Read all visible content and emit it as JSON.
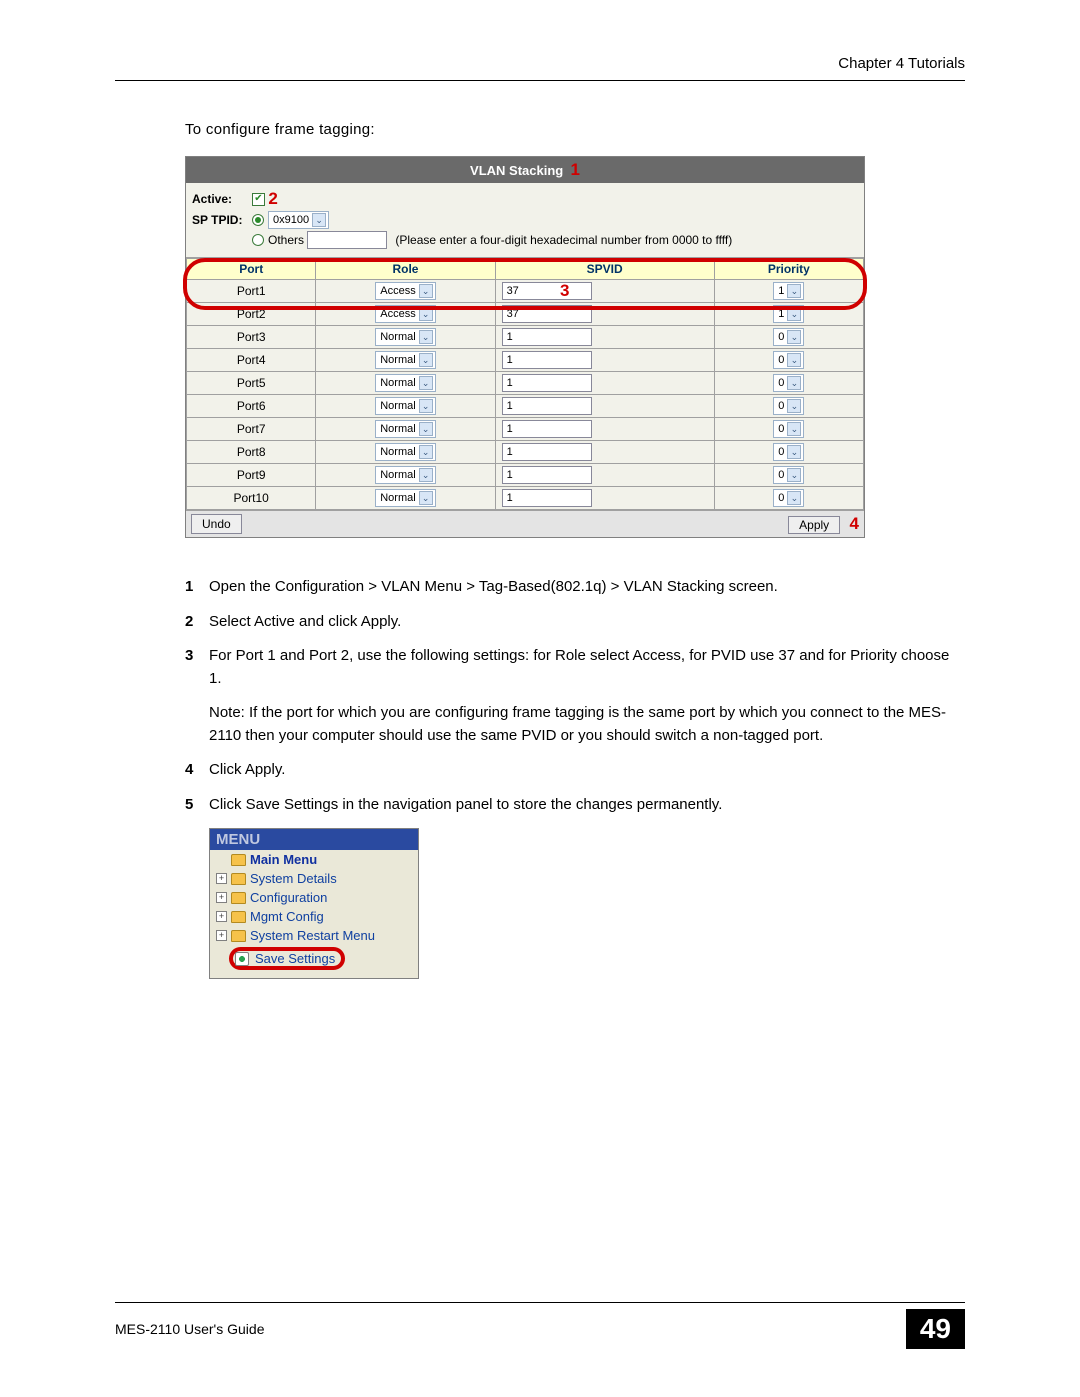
{
  "header": {
    "chapter": "Chapter 4 Tutorials"
  },
  "intro": "To configure frame tagging:",
  "vlan": {
    "title": "VLAN Stacking",
    "callout1": "1",
    "active_label": "Active:",
    "callout2": "2",
    "sptpid_label": "SP TPID:",
    "tpid_value": "0x9100",
    "others_label": "Others",
    "hint": "(Please enter a four-digit hexadecimal number from 0000 to ffff)",
    "headers": {
      "port": "Port",
      "role": "Role",
      "spvid": "SPVID",
      "priority": "Priority"
    },
    "rows": [
      {
        "port": "Port1",
        "role": "Access",
        "spvid": "37",
        "priority": "1"
      },
      {
        "port": "Port2",
        "role": "Access",
        "spvid": "37",
        "priority": "1"
      },
      {
        "port": "Port3",
        "role": "Normal",
        "spvid": "1",
        "priority": "0"
      },
      {
        "port": "Port4",
        "role": "Normal",
        "spvid": "1",
        "priority": "0"
      },
      {
        "port": "Port5",
        "role": "Normal",
        "spvid": "1",
        "priority": "0"
      },
      {
        "port": "Port6",
        "role": "Normal",
        "spvid": "1",
        "priority": "0"
      },
      {
        "port": "Port7",
        "role": "Normal",
        "spvid": "1",
        "priority": "0"
      },
      {
        "port": "Port8",
        "role": "Normal",
        "spvid": "1",
        "priority": "0"
      },
      {
        "port": "Port9",
        "role": "Normal",
        "spvid": "1",
        "priority": "0"
      },
      {
        "port": "Port10",
        "role": "Normal",
        "spvid": "1",
        "priority": "0"
      }
    ],
    "callout3": "3",
    "undo": "Undo",
    "apply": "Apply",
    "callout4": "4"
  },
  "steps": {
    "s1_num": "1",
    "s1": "Open the Configuration > VLAN Menu > Tag-Based(802.1q) > VLAN Stacking screen.",
    "s2_num": "2",
    "s2": "Select Active and click Apply.",
    "s3_num": "3",
    "s3": "For Port 1 and Port 2, use the following settings: for Role select Access, for PVID use 37 and for Priority choose 1.",
    "note": "Note: If the port for which you are configuring frame tagging is the same port by which you connect to the MES-2110 then your computer should use the same PVID or you should switch a non-tagged port.",
    "s4_num": "4",
    "s4": "Click Apply.",
    "s5_num": "5",
    "s5": "Click Save Settings in the navigation panel to store the changes permanently."
  },
  "menu": {
    "title": "MENU",
    "main": "Main Menu",
    "items": [
      "System Details",
      "Configuration",
      "Mgmt Config",
      "System Restart Menu"
    ],
    "save": "Save Settings"
  },
  "footer": {
    "guide": "MES-2110 User's Guide",
    "page": "49"
  }
}
